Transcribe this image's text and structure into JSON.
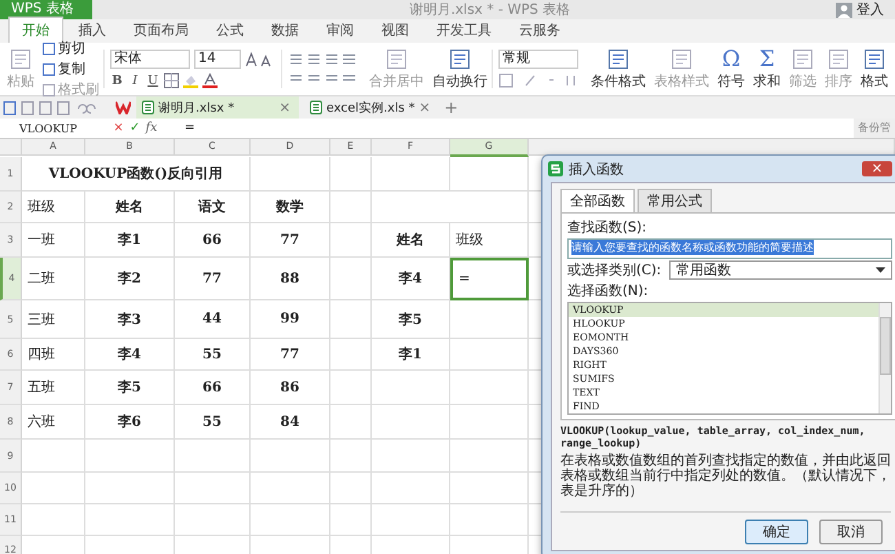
{
  "title_bar": {
    "app_button": "WPS 表格",
    "title": "谢明月.xlsx * - WPS 表格",
    "login": "登入"
  },
  "menu_tabs": [
    {
      "label": "开始",
      "selected": true
    },
    {
      "label": "插入",
      "selected": false
    },
    {
      "label": "页面布局",
      "selected": false
    },
    {
      "label": "公式",
      "selected": false
    },
    {
      "label": "数据",
      "selected": false
    },
    {
      "label": "审阅",
      "selected": false
    },
    {
      "label": "视图",
      "selected": false
    },
    {
      "label": "开发工具",
      "selected": false
    },
    {
      "label": "云服务",
      "selected": false
    }
  ],
  "ribbon": [
    {
      "kind": "large",
      "label": "粘贴",
      "disabled": true
    },
    {
      "kind": "stack",
      "items": [
        {
          "label": "剪切",
          "disabled": false
        },
        {
          "label": "复制",
          "disabled": false
        },
        {
          "label": "格式刷",
          "disabled": true
        }
      ]
    },
    {
      "kind": "font",
      "font": "宋体",
      "size": "14",
      "styles": [
        "B",
        "I",
        "U"
      ]
    },
    {
      "kind": "align"
    },
    {
      "kind": "large",
      "label": "合并居中",
      "disabled": true
    },
    {
      "kind": "large",
      "label": "自动换行",
      "disabled": false
    },
    {
      "kind": "number",
      "format": "常规"
    },
    {
      "kind": "large",
      "label": "条件格式",
      "disabled": false
    },
    {
      "kind": "large",
      "label": "表格样式",
      "disabled": true
    },
    {
      "kind": "glyph",
      "glyph": "Ω",
      "label": "符号",
      "disabled": false
    },
    {
      "kind": "glyph",
      "glyph": "Σ",
      "label": "求和",
      "disabled": false
    },
    {
      "kind": "large",
      "label": "筛选",
      "disabled": true
    },
    {
      "kind": "large",
      "label": "排序",
      "disabled": true
    },
    {
      "kind": "large",
      "label": "格式",
      "disabled": false
    }
  ],
  "doc_tabs": [
    {
      "label": "谢明月.xlsx *",
      "close": "×",
      "selected": true
    },
    {
      "label": "excel实例.xls *",
      "close": "×",
      "selected": false
    }
  ],
  "new_tab": "+",
  "formula_bar": {
    "name_box": "VLOOKUP",
    "buttons": [
      "×",
      "✓",
      "fx"
    ],
    "content": "=",
    "side_label": "备份管"
  },
  "sheet": {
    "columns": [
      {
        "label": "A",
        "selected": false
      },
      {
        "label": "B",
        "selected": false
      },
      {
        "label": "C",
        "selected": false
      },
      {
        "label": "D",
        "selected": false
      },
      {
        "label": "E",
        "selected": false
      },
      {
        "label": "F",
        "selected": false
      },
      {
        "label": "G",
        "selected": true
      }
    ],
    "rows": [
      {
        "number": "1",
        "selected": false,
        "cells": [
          {
            "text": "VLOOKUP函数()反向引用",
            "selected": false
          },
          null,
          null,
          null,
          null,
          null,
          null
        ]
      },
      {
        "number": "2",
        "selected": false,
        "cells": [
          {
            "text": "班级",
            "selected": false
          },
          {
            "text": "姓名",
            "selected": false
          },
          {
            "text": "语文",
            "selected": false
          },
          {
            "text": "数学",
            "selected": false
          },
          null,
          null,
          null
        ]
      },
      {
        "number": "3",
        "selected": false,
        "cells": [
          {
            "text": "一班",
            "selected": false
          },
          {
            "text": "李1",
            "selected": false
          },
          {
            "text": "66",
            "selected": false
          },
          {
            "text": "77",
            "selected": false
          },
          null,
          {
            "text": "姓名",
            "selected": false
          },
          {
            "text": "班级",
            "selected": false
          }
        ]
      },
      {
        "number": "4",
        "selected": true,
        "cells": [
          {
            "text": "二班",
            "selected": false
          },
          {
            "text": "李2",
            "selected": false
          },
          {
            "text": "77",
            "selected": false
          },
          {
            "text": "88",
            "selected": false
          },
          null,
          {
            "text": "李4",
            "selected": false
          },
          {
            "text": "=",
            "selected": true
          }
        ]
      },
      {
        "number": "5",
        "selected": false,
        "cells": [
          {
            "text": "三班",
            "selected": false
          },
          {
            "text": "李3",
            "selected": false
          },
          {
            "text": "44",
            "selected": false
          },
          {
            "text": "99",
            "selected": false
          },
          null,
          {
            "text": "李5",
            "selected": false
          },
          null
        ]
      },
      {
        "number": "6",
        "selected": false,
        "cells": [
          {
            "text": "四班",
            "selected": false
          },
          {
            "text": "李4",
            "selected": false
          },
          {
            "text": "55",
            "selected": false
          },
          {
            "text": "77",
            "selected": false
          },
          null,
          {
            "text": "李1",
            "selected": false
          },
          null
        ]
      },
      {
        "number": "7",
        "selected": false,
        "cells": [
          {
            "text": "五班",
            "selected": false
          },
          {
            "text": "李5",
            "selected": false
          },
          {
            "text": "66",
            "selected": false
          },
          {
            "text": "86",
            "selected": false
          },
          null,
          null,
          null
        ]
      },
      {
        "number": "8",
        "selected": false,
        "cells": [
          {
            "text": "六班",
            "selected": false
          },
          {
            "text": "李6",
            "selected": false
          },
          {
            "text": "55",
            "selected": false
          },
          {
            "text": "84",
            "selected": false
          },
          null,
          null,
          null
        ]
      },
      {
        "number": "9",
        "selected": false
      },
      {
        "number": "10",
        "selected": false
      },
      {
        "number": "11",
        "selected": false
      },
      {
        "number": "12",
        "selected": false
      }
    ]
  },
  "dialog": {
    "title": "插入函数",
    "close": "×",
    "tabs": [
      {
        "label": "全部函数",
        "selected": true
      },
      {
        "label": "常用公式",
        "selected": false
      }
    ],
    "search_label": "查找函数(S):",
    "search_value": "请输入您要查找的函数名称或函数功能的简要描述",
    "search_highlighted": true,
    "category_label": "或选择类别(C):",
    "category": "常用函数",
    "list_label": "选择函数(N):",
    "functions": [
      {
        "name": "VLOOKUP",
        "selected": true
      },
      {
        "name": "HLOOKUP",
        "selected": false
      },
      {
        "name": "EOMONTH",
        "selected": false
      },
      {
        "name": "DAYS360",
        "selected": false
      },
      {
        "name": "RIGHT",
        "selected": false
      },
      {
        "name": "SUMIFS",
        "selected": false
      },
      {
        "name": "TEXT",
        "selected": false
      },
      {
        "name": "FIND",
        "selected": false
      }
    ],
    "signature": "VLOOKUP(lookup_value, table_array, col_index_num, range_lookup)",
    "description": "在表格或数值数组的首列查找指定的数值，并由此返回表格或数组当前行中指定列处的数值。（默认情况下，表是升序的）",
    "buttons": [
      {
        "label": "确定",
        "default": true
      },
      {
        "label": "取消",
        "default": false
      }
    ]
  }
}
